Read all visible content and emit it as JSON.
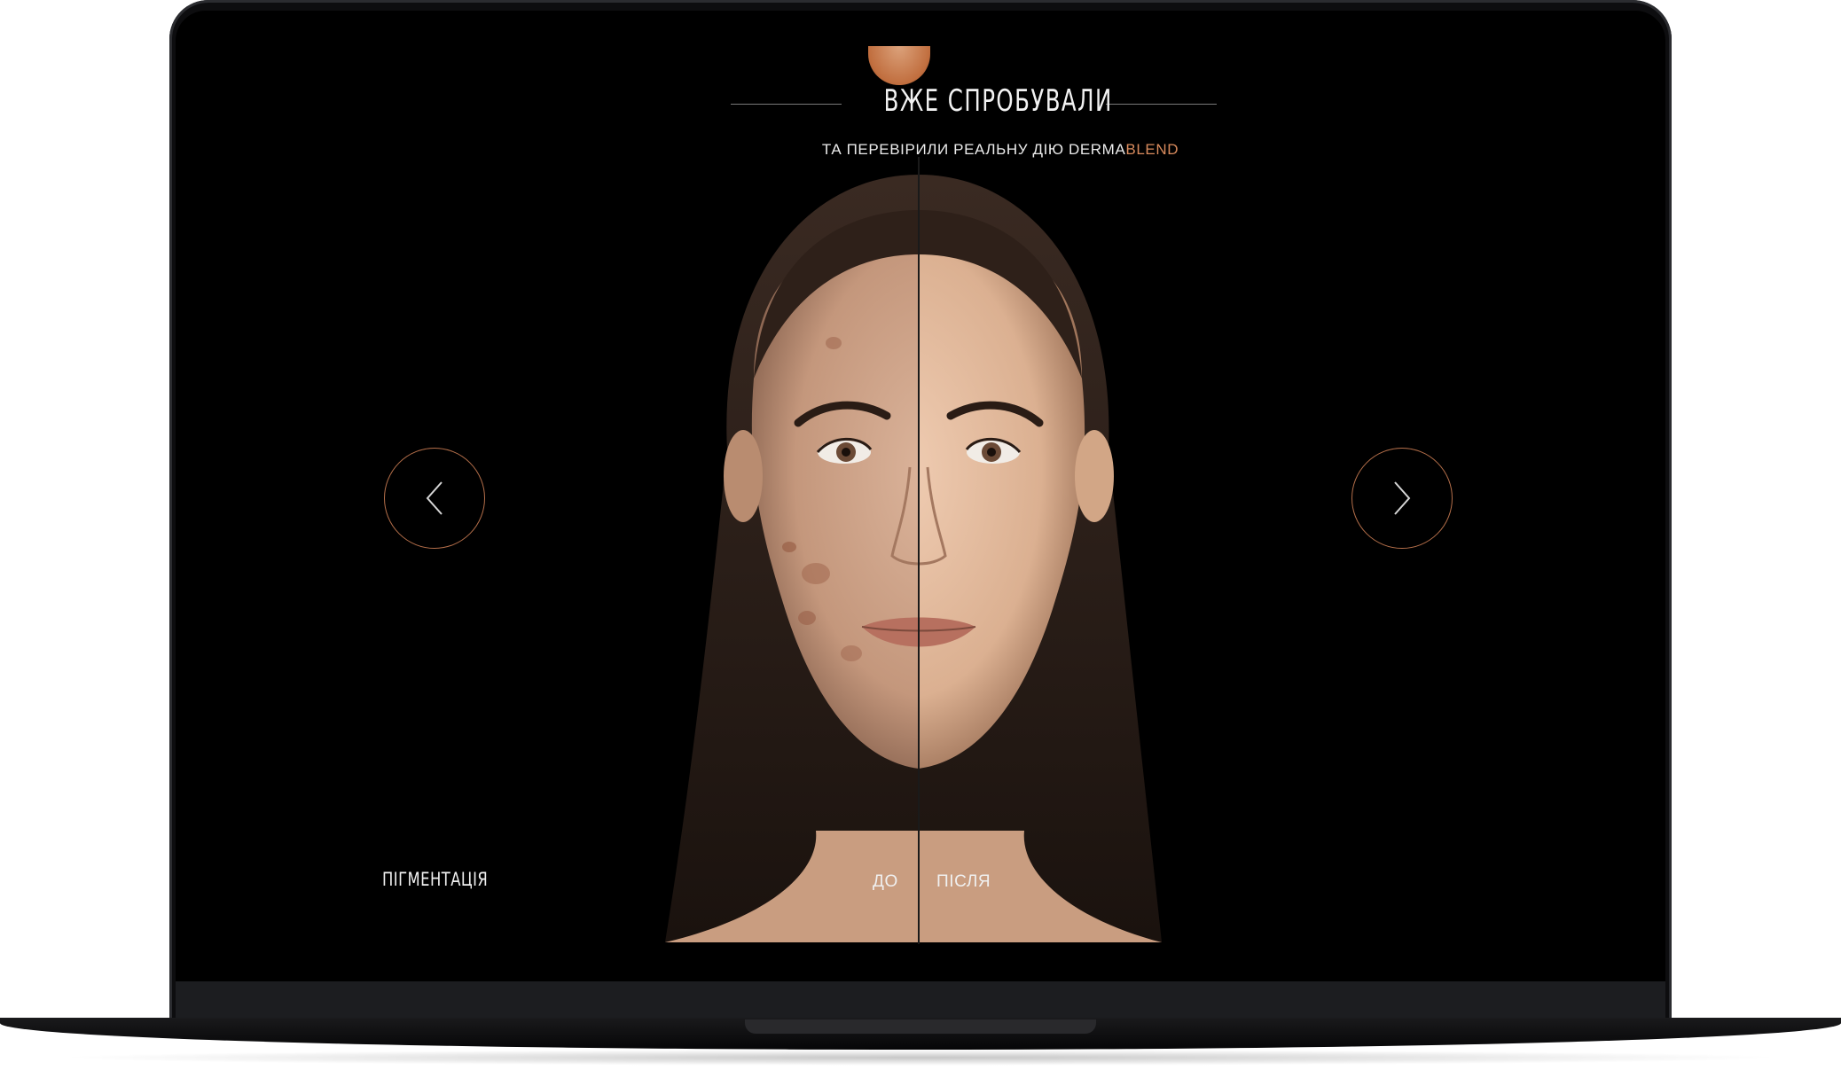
{
  "section": {
    "heading": "ВЖЕ СПРОБУВАЛИ",
    "subheading_prefix": "ТА ПЕРЕВІРИЛИ РЕАЛЬНУ ДІЮ DERMA",
    "subheading_accent": "BLEND"
  },
  "comparison": {
    "category_label": "ПІГМЕНТАЦІЯ",
    "before_label": "ДО",
    "after_label": "ПІСЛЯ",
    "image": "before-after-face-photo"
  },
  "navigation": {
    "prev_icon": "chevron-left-icon",
    "next_icon": "chevron-right-icon"
  },
  "colors": {
    "background": "#000000",
    "accent": "#d98b5d",
    "arrow_ring": "#b56f4a",
    "text": "#f0f0f0"
  }
}
